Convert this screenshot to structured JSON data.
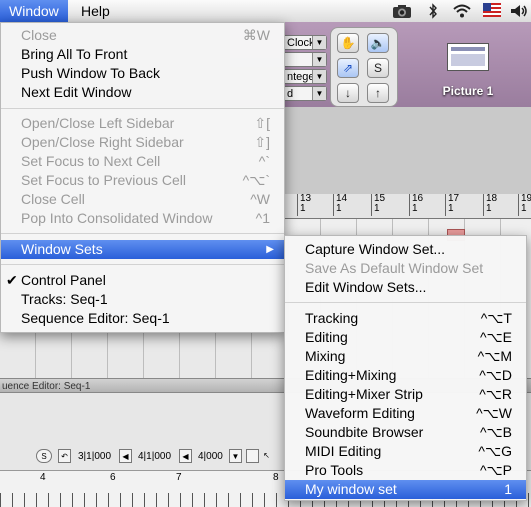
{
  "menubar": {
    "items": [
      {
        "label": "Window",
        "active": true
      },
      {
        "label": "Help",
        "active": false
      }
    ],
    "tray_icons": [
      "camera-icon",
      "bluetooth-icon",
      "wifi-icon",
      "us-flag-icon",
      "volume-icon"
    ]
  },
  "background": {
    "dropdowns": [
      "Clock",
      "",
      "nteger",
      "d"
    ],
    "picture_label": "Picture 1",
    "ruler_marks": [
      {
        "num": "13",
        "sub": "1"
      },
      {
        "num": "14",
        "sub": "1"
      },
      {
        "num": "15",
        "sub": "1"
      },
      {
        "num": "16",
        "sub": "1"
      },
      {
        "num": "17",
        "sub": "1"
      },
      {
        "num": "18",
        "sub": "1"
      },
      {
        "num": "19",
        "sub": "1"
      }
    ],
    "sequence_editor_title": "uence Editor: Seq-1",
    "transport": {
      "s_label": "S",
      "pos1": "3|1|000",
      "pos2": "4|1|000",
      "pos3": "4|000"
    },
    "bottom_ruler_labels": [
      "4",
      "6",
      "7",
      "8"
    ]
  },
  "window_menu": {
    "items": [
      {
        "label": "Close",
        "shortcut": "⌘W",
        "disabled": true
      },
      {
        "label": "Bring All To Front",
        "shortcut": "",
        "disabled": false
      },
      {
        "label": "Push Window To Back",
        "shortcut": "",
        "disabled": false
      },
      {
        "label": "Next Edit Window",
        "shortcut": "",
        "disabled": false
      },
      {
        "label": "Open/Close Left Sidebar",
        "shortcut": "⇧[",
        "disabled": true
      },
      {
        "label": "Open/Close Right Sidebar",
        "shortcut": "⇧]",
        "disabled": true
      },
      {
        "label": "Set Focus to Next Cell",
        "shortcut": "^`",
        "disabled": true
      },
      {
        "label": "Set Focus to Previous Cell",
        "shortcut": "^⌥`",
        "disabled": true
      },
      {
        "label": "Close Cell",
        "shortcut": "^W",
        "disabled": true
      },
      {
        "label": "Pop Into Consolidated Window",
        "shortcut": "^1",
        "disabled": true
      },
      {
        "label": "Window Sets",
        "shortcut": "",
        "disabled": false,
        "highlighted": true,
        "submenu": true
      },
      {
        "label": "Control Panel",
        "shortcut": "",
        "disabled": false,
        "checked": true
      },
      {
        "label": "Tracks: Seq-1",
        "shortcut": "",
        "disabled": false
      },
      {
        "label": "Sequence Editor: Seq-1",
        "shortcut": "",
        "disabled": false
      }
    ]
  },
  "windowsets_menu": {
    "items": [
      {
        "label": "Capture Window Set...",
        "shortcut": "",
        "disabled": false
      },
      {
        "label": "Save As Default Window Set",
        "shortcut": "",
        "disabled": true
      },
      {
        "label": "Edit Window Sets...",
        "shortcut": "",
        "disabled": false
      },
      {
        "label": "Tracking",
        "shortcut": "^⌥T",
        "disabled": false
      },
      {
        "label": "Editing",
        "shortcut": "^⌥E",
        "disabled": false
      },
      {
        "label": "Mixing",
        "shortcut": "^⌥M",
        "disabled": false
      },
      {
        "label": "Editing+Mixing",
        "shortcut": "^⌥D",
        "disabled": false
      },
      {
        "label": "Editing+Mixer Strip",
        "shortcut": "^⌥R",
        "disabled": false
      },
      {
        "label": "Waveform Editing",
        "shortcut": "^⌥W",
        "disabled": false
      },
      {
        "label": "Soundbite Browser",
        "shortcut": "^⌥B",
        "disabled": false
      },
      {
        "label": "MIDI Editing",
        "shortcut": "^⌥G",
        "disabled": false
      },
      {
        "label": "Pro Tools",
        "shortcut": "^⌥P",
        "disabled": false
      },
      {
        "label": "My window set",
        "shortcut": "1",
        "disabled": false,
        "highlighted": true
      }
    ]
  },
  "colors": {
    "highlight": "#2a5fd9",
    "disabled_text": "#9b9b9b",
    "menubar_bg": "#e8e8e8"
  }
}
